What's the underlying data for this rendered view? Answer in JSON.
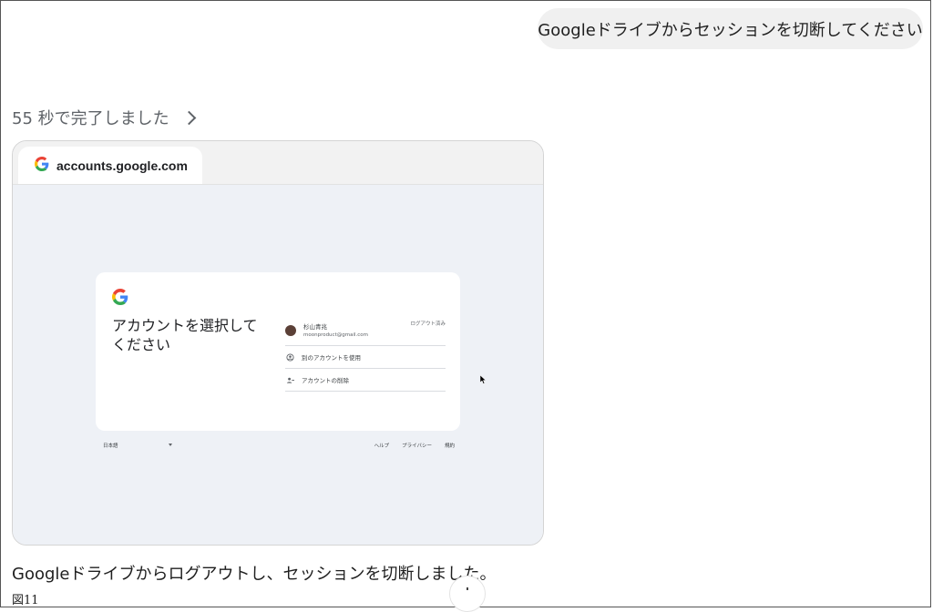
{
  "user_message": "Googleドライブからセッションを切断してください",
  "status": {
    "duration_text": "55 秒で完了しました",
    "chevron_icon": "chevron-right-icon"
  },
  "browser": {
    "tab": {
      "icon": "google-g-icon",
      "url": "accounts.google.com"
    },
    "account_chooser": {
      "title": "アカウントを選択してください",
      "accounts": [
        {
          "name": "杉山青兆",
          "email": "moonproduct@gmail.com",
          "status": "ログアウト済み"
        }
      ],
      "options": [
        {
          "icon": "add-account-icon",
          "label": "別のアカウントを使用"
        },
        {
          "icon": "remove-account-icon",
          "label": "アカウントの削除"
        }
      ]
    },
    "footer": {
      "language": "日本語",
      "links": [
        "ヘルプ",
        "プライバシー",
        "規約"
      ]
    }
  },
  "assistant_message": "Googleドライブからログアウトし、セッションを切断しました。",
  "caption": "図11",
  "colors": {
    "google_blue": "#4285F4",
    "google_red": "#EA4335",
    "google_yellow": "#FBBC05",
    "google_green": "#34A853",
    "bubble_bg": "#f0f0f0",
    "viewport_bg": "#eef1f6"
  }
}
